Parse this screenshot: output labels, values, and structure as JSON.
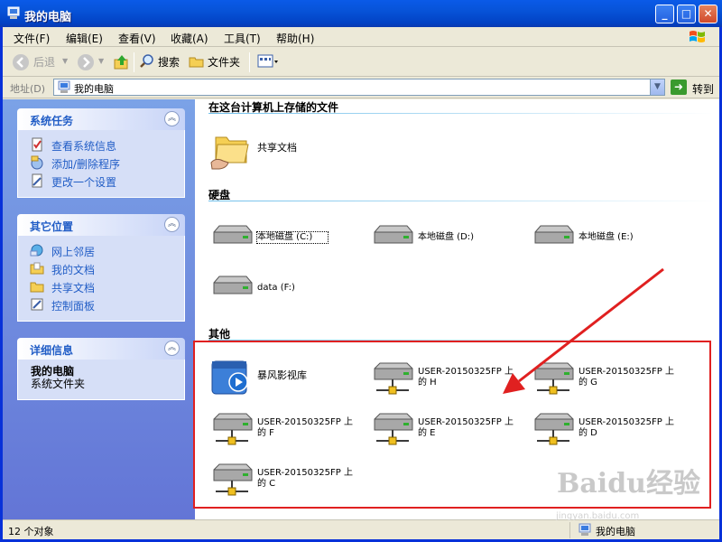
{
  "window": {
    "title": "我的电脑"
  },
  "menu": {
    "items": [
      "文件(F)",
      "编辑(E)",
      "查看(V)",
      "收藏(A)",
      "工具(T)",
      "帮助(H)"
    ]
  },
  "toolbar": {
    "back_label": "后退",
    "search_label": "搜索",
    "folders_label": "文件夹"
  },
  "address": {
    "label": "地址(D)",
    "value": "我的电脑",
    "go_label": "转到"
  },
  "left_pane": {
    "system_tasks": {
      "title": "系统任务",
      "links": [
        "查看系统信息",
        "添加/删除程序",
        "更改一个设置"
      ]
    },
    "other_places": {
      "title": "其它位置",
      "links": [
        "网上邻居",
        "我的文档",
        "共享文档",
        "控制面板"
      ]
    },
    "details": {
      "title": "详细信息",
      "name": "我的电脑",
      "type": "系统文件夹"
    }
  },
  "sections": {
    "stored": {
      "title": "在这台计算机上存储的文件",
      "items": [
        "共享文档"
      ]
    },
    "hard_disks": {
      "title": "硬盘",
      "items": [
        "本地磁盘 (C:)",
        "本地磁盘 (D:)",
        "本地磁盘 (E:)",
        "data (F:)"
      ]
    },
    "other": {
      "title": "其他",
      "items": [
        "暴风影视库",
        "USER-20150325FP 上\n的 H",
        "USER-20150325FP 上\n的 G",
        "USER-20150325FP 上\n的 F",
        "USER-20150325FP 上\n的 E",
        "USER-20150325FP 上\n的 D",
        "USER-20150325FP 上\n的 C"
      ]
    }
  },
  "status": {
    "count": "12 个对象",
    "location": "我的电脑"
  },
  "watermark": {
    "brand": "Baidu经验",
    "url": "jingyan.baidu.com"
  },
  "colors": {
    "titlebar": "#0753d8",
    "panel_link": "#215dc6",
    "annotation": "#e02020"
  }
}
